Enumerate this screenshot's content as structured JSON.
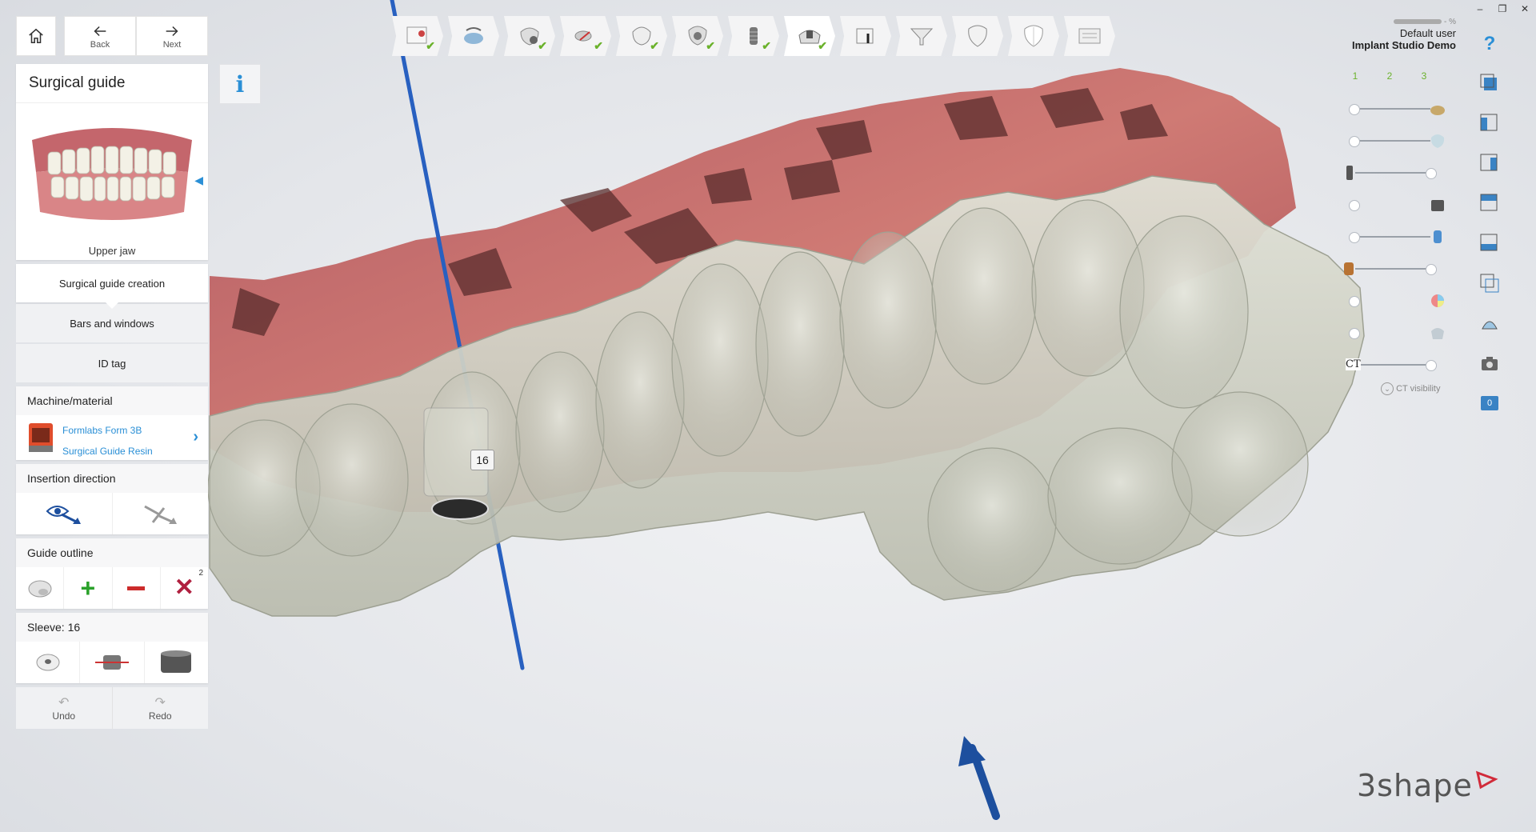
{
  "window": {
    "controls": [
      "–",
      "❐",
      "✕"
    ]
  },
  "topbar": {
    "back_label": "Back",
    "next_label": "Next",
    "user_name": "Default user",
    "project_name": "Implant Studio Demo",
    "user_status": "- %",
    "help_icon": "question-icon"
  },
  "steps": [
    {
      "name": "order-step",
      "done": true,
      "active": false
    },
    {
      "name": "scan-alignment-step",
      "done": false,
      "active": false
    },
    {
      "name": "settings-step",
      "done": true,
      "active": false
    },
    {
      "name": "cutting-step",
      "done": true,
      "active": false
    },
    {
      "name": "tooth-step",
      "done": true,
      "active": false
    },
    {
      "name": "tooth-settings-step",
      "done": true,
      "active": false
    },
    {
      "name": "implant-step",
      "done": true,
      "active": false
    },
    {
      "name": "surgical-guide-step",
      "done": true,
      "active": true
    },
    {
      "name": "drill-protocol-step",
      "done": false,
      "active": false
    },
    {
      "name": "funnel-step",
      "done": false,
      "active": false
    },
    {
      "name": "crown-step",
      "done": false,
      "active": false
    },
    {
      "name": "crown-outline-step",
      "done": false,
      "active": false
    },
    {
      "name": "report-step",
      "done": false,
      "active": false
    }
  ],
  "panel": {
    "title": "Surgical guide",
    "jaw_label": "Upper jaw",
    "tabs": [
      "Surgical guide creation",
      "Bars and windows",
      "ID tag"
    ],
    "machine_section": "Machine/material",
    "machine_name": "Formlabs Form 3B",
    "material_name": "Surgical Guide Resin",
    "insertion_section": "Insertion direction",
    "outline_section": "Guide outline",
    "outline_badge": "2",
    "sleeve_section": "Sleeve: 16",
    "undo_label": "Undo",
    "redo_label": "Redo"
  },
  "viewport": {
    "sleeve_tag": "16",
    "brand": "3shape"
  },
  "layers": {
    "tabs": [
      "1",
      "2",
      "3"
    ],
    "ct_label": "CT",
    "ct_visibility_label": "CT visibility",
    "rows": [
      {
        "name": "model-layer",
        "level": 1.0
      },
      {
        "name": "crown-layer",
        "level": 1.0
      },
      {
        "name": "implant-layer",
        "level": 0.0
      },
      {
        "name": "sleeve-layer",
        "level": 0.0
      },
      {
        "name": "drill-layer",
        "level": 1.0
      },
      {
        "name": "gingiva-layer",
        "level": 0.0
      },
      {
        "name": "color-layer",
        "level": 0.0
      },
      {
        "name": "guide-layer",
        "level": 0.0
      },
      {
        "name": "ct-layer",
        "level": 0.0
      }
    ]
  },
  "right_tools": {
    "badge_value": "0"
  },
  "colors": {
    "accent": "#2a8fd6",
    "check": "#6bb22c",
    "add": "#2aa12a",
    "remove": "#cc2b2b",
    "delete": "#b0203f",
    "axis": "#2860c0",
    "brand_red": "#d12b3a",
    "guide": "#c9cbbd",
    "gum": "#c86a6a"
  }
}
